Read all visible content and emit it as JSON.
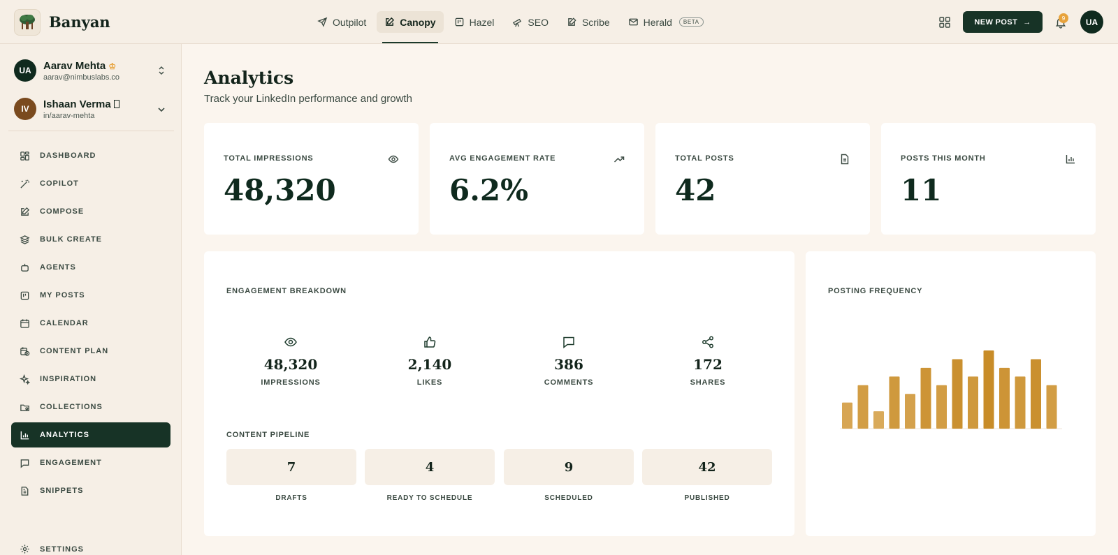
{
  "app": {
    "brand": "Banyan"
  },
  "topnav": {
    "items": [
      {
        "label": "Outpilot",
        "icon": "send-icon",
        "active": false
      },
      {
        "label": "Canopy",
        "icon": "edit-icon",
        "active": true
      },
      {
        "label": "Hazel",
        "icon": "board-icon",
        "active": false
      },
      {
        "label": "SEO",
        "icon": "telescope-icon",
        "active": false
      },
      {
        "label": "Scribe",
        "icon": "pen-icon",
        "active": false
      },
      {
        "label": "Herald",
        "icon": "mail-icon",
        "active": false,
        "badge": "BETA"
      }
    ],
    "new_post_label": "NEW POST",
    "notification_count": "9",
    "user_initials": "UA"
  },
  "sidebar": {
    "accounts": [
      {
        "initials": "UA",
        "name": "Aarav Mehta",
        "sub": "aarav@nimbuslabs.co",
        "color": "#0f2a1e"
      },
      {
        "initials": "IV",
        "name": "Ishaan Verma",
        "sub": "in/aarav-mehta",
        "color": "#7a4a1e"
      }
    ],
    "items": [
      {
        "label": "DASHBOARD",
        "icon": "dashboard-icon"
      },
      {
        "label": "COPILOT",
        "icon": "wand-icon"
      },
      {
        "label": "COMPOSE",
        "icon": "compose-icon"
      },
      {
        "label": "BULK CREATE",
        "icon": "layers-icon"
      },
      {
        "label": "AGENTS",
        "icon": "bot-icon"
      },
      {
        "label": "MY POSTS",
        "icon": "posts-icon"
      },
      {
        "label": "CALENDAR",
        "icon": "calendar-icon"
      },
      {
        "label": "CONTENT PLAN",
        "icon": "calendar-clock-icon"
      },
      {
        "label": "INSPIRATION",
        "icon": "sparkles-icon"
      },
      {
        "label": "COLLECTIONS",
        "icon": "folder-icon"
      },
      {
        "label": "ANALYTICS",
        "icon": "bar-chart-icon",
        "active": true
      },
      {
        "label": "ENGAGEMENT",
        "icon": "message-icon"
      },
      {
        "label": "SNIPPETS",
        "icon": "file-text-icon"
      }
    ],
    "settings_label": "SETTINGS"
  },
  "page": {
    "title": "Analytics",
    "subtitle": "Track your LinkedIn performance and growth"
  },
  "stats": [
    {
      "label": "TOTAL IMPRESSIONS",
      "value": "48,320",
      "icon": "eye-icon"
    },
    {
      "label": "AVG ENGAGEMENT RATE",
      "value": "6.2%",
      "icon": "trending-up-icon"
    },
    {
      "label": "TOTAL POSTS",
      "value": "42",
      "icon": "document-icon"
    },
    {
      "label": "POSTS THIS MONTH",
      "value": "11",
      "icon": "bar-chart-icon"
    }
  ],
  "engagement": {
    "title": "ENGAGEMENT BREAKDOWN",
    "items": [
      {
        "value": "48,320",
        "label": "IMPRESSIONS",
        "icon": "eye-icon"
      },
      {
        "value": "2,140",
        "label": "LIKES",
        "icon": "thumbs-up-icon"
      },
      {
        "value": "386",
        "label": "COMMENTS",
        "icon": "comment-icon"
      },
      {
        "value": "172",
        "label": "SHARES",
        "icon": "share-icon"
      }
    ]
  },
  "pipeline": {
    "title": "CONTENT PIPELINE",
    "items": [
      {
        "value": "7",
        "label": "DRAFTS"
      },
      {
        "value": "4",
        "label": "READY TO SCHEDULE"
      },
      {
        "value": "9",
        "label": "SCHEDULED"
      },
      {
        "value": "42",
        "label": "PUBLISHED"
      }
    ]
  },
  "frequency": {
    "title": "POSTING FREQUENCY",
    "bar_color": "#d4a24c"
  },
  "chart_data": {
    "type": "bar",
    "title": "POSTING FREQUENCY",
    "categories": [],
    "values": [
      3,
      5,
      2,
      6,
      4,
      7,
      5,
      8,
      6,
      9,
      7,
      6,
      8,
      5
    ],
    "ylim": [
      0,
      9
    ],
    "grid": false
  },
  "colors": {
    "accent": "#173326",
    "gold": "#d4a24c",
    "bg": "#fbf5ee"
  }
}
